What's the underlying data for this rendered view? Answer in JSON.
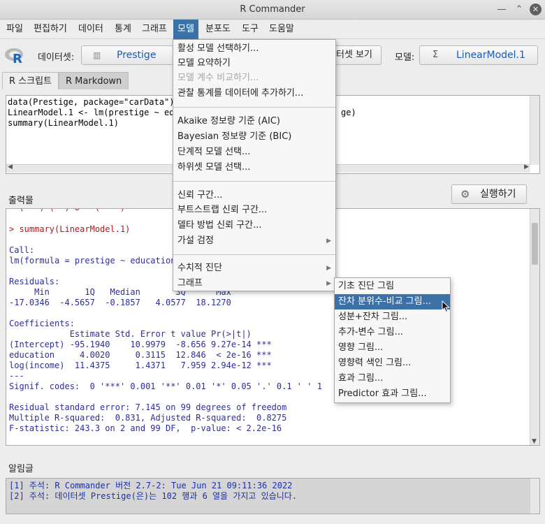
{
  "window": {
    "title": "R Commander"
  },
  "menubar": [
    "파일",
    "편집하기",
    "데이터",
    "통계",
    "그래프",
    "모델",
    "분포도",
    "도구",
    "도움말"
  ],
  "toolbar": {
    "dataset_label": "데이터셋:",
    "dataset_value": "Prestige",
    "view_dataset_button": "터셋 보기",
    "model_label": "모델:",
    "model_value": "LinearModel.1"
  },
  "tabs": [
    "R 스크립트",
    "R Markdown"
  ],
  "script": {
    "lines": [
      "data(Prestige, package=\"carData\")",
      "LinearModel.1 <- lm(prestige ~ edu",
      "summary(LinearModel.1)"
    ],
    "line2_tail": "ge)"
  },
  "output": {
    "label": "출력물",
    "run_button": "실행하기",
    "lines": [
      "> summary(LinearModel.1)",
      "",
      "Call:",
      "lm(formula = prestige ~ education",
      "",
      "Residuals:",
      "     Min       1Q   Median       3Q      Max ",
      "-17.0346  -4.5657  -0.1857   4.0577  18.1270 ",
      "",
      "Coefficients:",
      "            Estimate Std. Error t value Pr(>|t|)    ",
      "(Intercept) -95.1940    10.9979  -8.656 9.27e-14 ***",
      "education     4.0020     0.3115  12.846  < 2e-16 ***",
      "log(income)  11.4375     1.4371   7.959 2.94e-12 ***",
      "---",
      "Signif. codes:  0 '***' 0.001 '**' 0.01 '*' 0.05 '.' 0.1 ' ' 1",
      "",
      "Residual standard error: 7.145 on 99 degrees of freedom",
      "Multiple R-squared:  0.831, Adjusted R-squared:  0.8275 ",
      "F-statistic: 243.3 on 2 and 99 DF,  p-value: < 2.2e-16"
    ]
  },
  "messages": {
    "label": "알림글",
    "lines": [
      "[1] 주석: R Commander 버전 2.7-2: Tue Jun 21 09:11:36 2022",
      "[2] 주석: 데이터셋 Prestige(은)는 102 행과 6 열을 가지고 있습니다."
    ]
  },
  "model_menu": {
    "items": [
      "활성 모델 선택하기...",
      "모델 요약하기",
      "모델 계수 비교하기...",
      "관찰 통계를 데이터에 추가하기...",
      "Akaike 정보량 기준 (AIC)",
      "Bayesian 정보량 기준 (BIC)",
      "단계적 모델 선택...",
      "하위셋 모델 선택...",
      "신뢰 구간...",
      "부트스트랩 신뢰 구간...",
      "델타 방법 신뢰 구간...",
      "가설 검정",
      "수치적 진단",
      "그래프"
    ],
    "disabled_item": "모델 계수 비교하기..."
  },
  "graph_submenu": {
    "items": [
      "기초 진단 그림",
      "잔차 분위수-비교 그림...",
      "성분+잔차 그림...",
      "추가-변수 그림...",
      "영향 그림...",
      "영향력 색인 그림...",
      "효과 그림...",
      "Predictor 효과 그림..."
    ],
    "highlighted": "잔차 분위수-비교 그림..."
  },
  "colors": {
    "accent": "#3c71a8",
    "command": "#b5161b",
    "output_text": "#2d2d9a",
    "message_text": "#1d2fa8",
    "dataset_text": "#1f58b4"
  }
}
